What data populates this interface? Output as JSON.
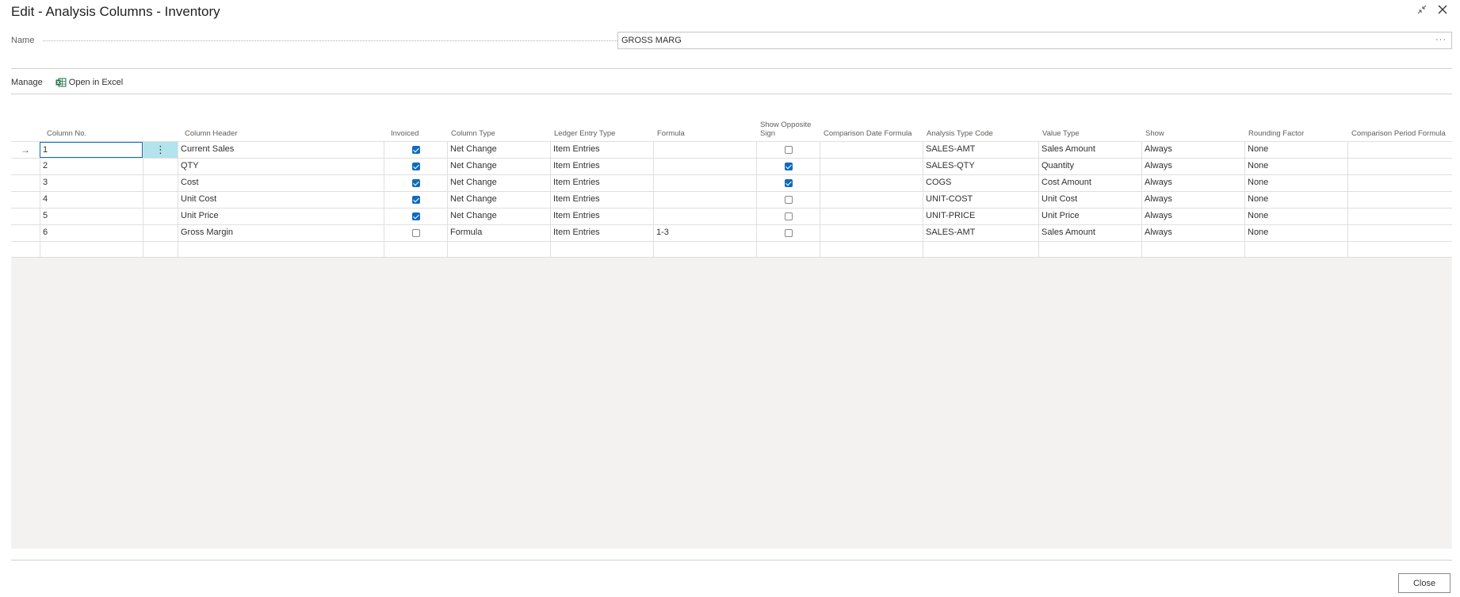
{
  "window": {
    "title": "Edit - Analysis Columns - Inventory"
  },
  "name_field": {
    "label": "Name",
    "value": "GROSS MARG",
    "ellipsis": "···"
  },
  "actions": {
    "manage": "Manage",
    "open_in_excel": "Open in Excel"
  },
  "table": {
    "headers": {
      "column_no": "Column No.",
      "column_header": "Column Header",
      "invoiced": "Invoiced",
      "column_type": "Column Type",
      "ledger_entry_type": "Ledger Entry Type",
      "formula": "Formula",
      "show_opposite_sign": "Show Opposite Sign",
      "comparison_date_formula": "Comparison Date Formula",
      "analysis_type_code": "Analysis Type Code",
      "value_type": "Value Type",
      "show": "Show",
      "rounding_factor": "Rounding Factor",
      "comparison_period_formula": "Comparison Period Formula"
    },
    "rows": [
      {
        "column_no": "1",
        "column_header": "Current Sales",
        "invoiced": true,
        "column_type": "Net Change",
        "ledger_entry_type": "Item Entries",
        "formula": "",
        "show_opposite_sign": false,
        "comparison_date_formula": "",
        "analysis_type_code": "SALES-AMT",
        "value_type": "Sales Amount",
        "show": "Always",
        "rounding_factor": "None",
        "comparison_period_formula": ""
      },
      {
        "column_no": "2",
        "column_header": "QTY",
        "invoiced": true,
        "column_type": "Net Change",
        "ledger_entry_type": "Item Entries",
        "formula": "",
        "show_opposite_sign": true,
        "comparison_date_formula": "",
        "analysis_type_code": "SALES-QTY",
        "value_type": "Quantity",
        "show": "Always",
        "rounding_factor": "None",
        "comparison_period_formula": ""
      },
      {
        "column_no": "3",
        "column_header": "Cost",
        "invoiced": true,
        "column_type": "Net Change",
        "ledger_entry_type": "Item Entries",
        "formula": "",
        "show_opposite_sign": true,
        "comparison_date_formula": "",
        "analysis_type_code": "COGS",
        "value_type": "Cost Amount",
        "show": "Always",
        "rounding_factor": "None",
        "comparison_period_formula": ""
      },
      {
        "column_no": "4",
        "column_header": "Unit Cost",
        "invoiced": true,
        "column_type": "Net Change",
        "ledger_entry_type": "Item Entries",
        "formula": "",
        "show_opposite_sign": false,
        "comparison_date_formula": "",
        "analysis_type_code": "UNIT-COST",
        "value_type": "Unit Cost",
        "show": "Always",
        "rounding_factor": "None",
        "comparison_period_formula": ""
      },
      {
        "column_no": "5",
        "column_header": "Unit Price",
        "invoiced": true,
        "column_type": "Net Change",
        "ledger_entry_type": "Item Entries",
        "formula": "",
        "show_opposite_sign": false,
        "comparison_date_formula": "",
        "analysis_type_code": "UNIT-PRICE",
        "value_type": "Unit Price",
        "show": "Always",
        "rounding_factor": "None",
        "comparison_period_formula": ""
      },
      {
        "column_no": "6",
        "column_header": "Gross Margin",
        "invoiced": false,
        "column_type": "Formula",
        "ledger_entry_type": "Item Entries",
        "formula": "1-3",
        "show_opposite_sign": false,
        "comparison_date_formula": "",
        "analysis_type_code": "SALES-AMT",
        "value_type": "Sales Amount",
        "show": "Always",
        "rounding_factor": "None",
        "comparison_period_formula": ""
      }
    ]
  },
  "footer": {
    "close": "Close"
  },
  "colors": {
    "accent": "#0f6cbd",
    "selected_cell": "#b3e3ec",
    "empty_area": "#f3f2f1"
  }
}
